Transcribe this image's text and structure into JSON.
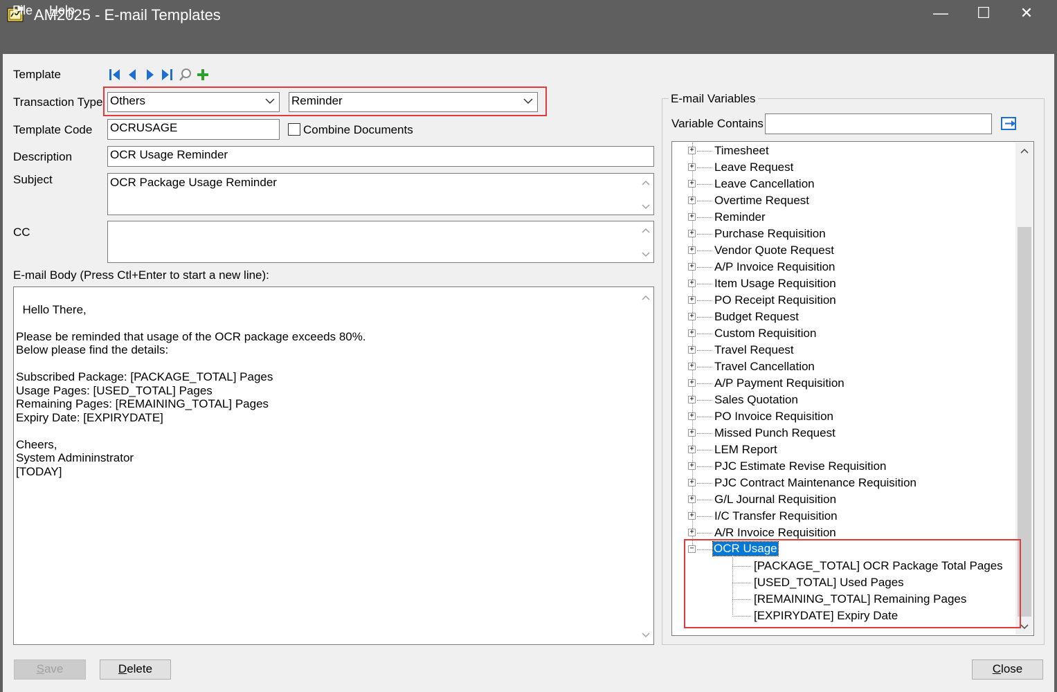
{
  "window": {
    "title": "AM2025 - E-mail Templates",
    "controls": {
      "minimize": "—",
      "maximize": "☐",
      "close": "✕"
    }
  },
  "menu": {
    "file_key": "F",
    "file_rest": "ile",
    "help_key": "H",
    "help_rest": "elp"
  },
  "form": {
    "template_label": "Template",
    "transaction_type_label": "Transaction Type",
    "transaction_type_value": "Others",
    "transaction_subtype_value": "Reminder",
    "template_code_label": "Template Code",
    "template_code_value": "OCRUSAGE",
    "combine_documents_label": "Combine Documents",
    "combine_documents_checked": false,
    "description_label": "Description",
    "description_value": "OCR Usage Reminder",
    "subject_label": "Subject",
    "subject_value": "OCR Package Usage Reminder",
    "cc_label": "CC",
    "cc_value": "",
    "body_label": "E-mail Body (Press Ctl+Enter to start a new line):",
    "body_value": "Hello There,\n\nPlease be reminded that usage of the OCR package exceeds 80%.\nBelow please find the details:\n\nSubscribed Package: [PACKAGE_TOTAL] Pages\nUsage Pages: [USED_TOTAL] Pages\nRemaining Pages: [REMAINING_TOTAL] Pages\nExpiry Date: [EXPIRYDATE]\n\nCheers,\nSystem Admininstrator\n[TODAY]"
  },
  "toolbar": {
    "icons": [
      "first-record-icon",
      "previous-record-icon",
      "next-record-icon",
      "last-record-icon",
      "search-icon",
      "add-icon"
    ]
  },
  "variables": {
    "group_title": "E-mail Variables",
    "contains_label": "Variable Contains",
    "contains_value": "",
    "tree_items": [
      "Timesheet",
      "Leave Request",
      "Leave Cancellation",
      "Overtime Request",
      "Reminder",
      "Purchase Requisition",
      "Vendor Quote Request",
      "A/P Invoice Requisition",
      "Item Usage Requisition",
      "PO Receipt Requisition",
      "Budget Request",
      "Custom Requisition",
      "Travel Request",
      "Travel Cancellation",
      "A/P Payment Requisition",
      "Sales Quotation",
      "PO Invoice Requisition",
      "Missed Punch Request",
      "LEM Report",
      "PJC Estimate Revise Requisition",
      "PJC Contract Maintenance Requisition",
      "G/L Journal Requisition",
      "I/C Transfer Requisition",
      "A/R Invoice Requisition"
    ],
    "expanded_item": "OCR Usage",
    "expanded_children": [
      "[PACKAGE_TOTAL] OCR Package Total Pages",
      "[USED_TOTAL] Used Pages",
      "[REMAINING_TOTAL] Remaining Pages",
      "[EXPIRYDATE] Expiry Date"
    ]
  },
  "buttons": {
    "save_key": "S",
    "save_rest": "ave",
    "delete_key": "D",
    "delete_rest": "elete",
    "close_key": "C",
    "close_rest": "lose"
  },
  "colors": {
    "titlebar": "#5f5f5f",
    "highlight_box": "#e0393e",
    "selection": "#0078d7",
    "nav_icons": "#1e6fd1",
    "add_icon": "#2ca02c"
  }
}
